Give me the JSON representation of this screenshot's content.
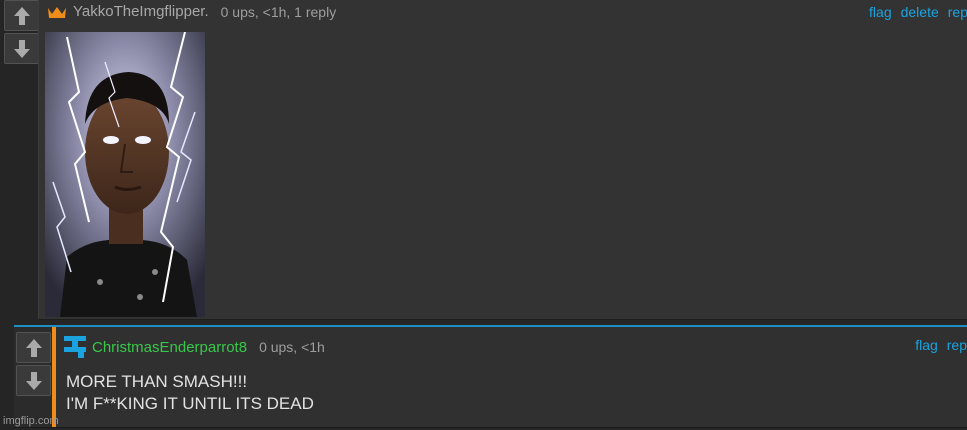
{
  "comment1": {
    "username": "YakkoTheImgflipper.",
    "stats": "0 ups, <1h, 1 reply",
    "actions": {
      "flag": "flag",
      "delete": "delete",
      "reply": "rep"
    },
    "badge_icon": "crown-icon",
    "badge_color": "#f08c1a"
  },
  "comment2": {
    "username": "ChristmasEnderparrot8",
    "stats": "0 ups, <1h",
    "actions": {
      "flag": "flag",
      "reply": "rep"
    },
    "text_line1": "MORE THAN SMASH!!!",
    "text_line2": "I'M F**KING IT UNTIL ITS DEAD",
    "avatar_icon": "pixel-avatar-icon",
    "accent_color": "#f08c1a",
    "thread_color": "#1e8fc4"
  },
  "watermark": "imgflip.com",
  "colors": {
    "link": "#1ba3e0",
    "username_green": "#37c84a",
    "background": "#252525"
  }
}
